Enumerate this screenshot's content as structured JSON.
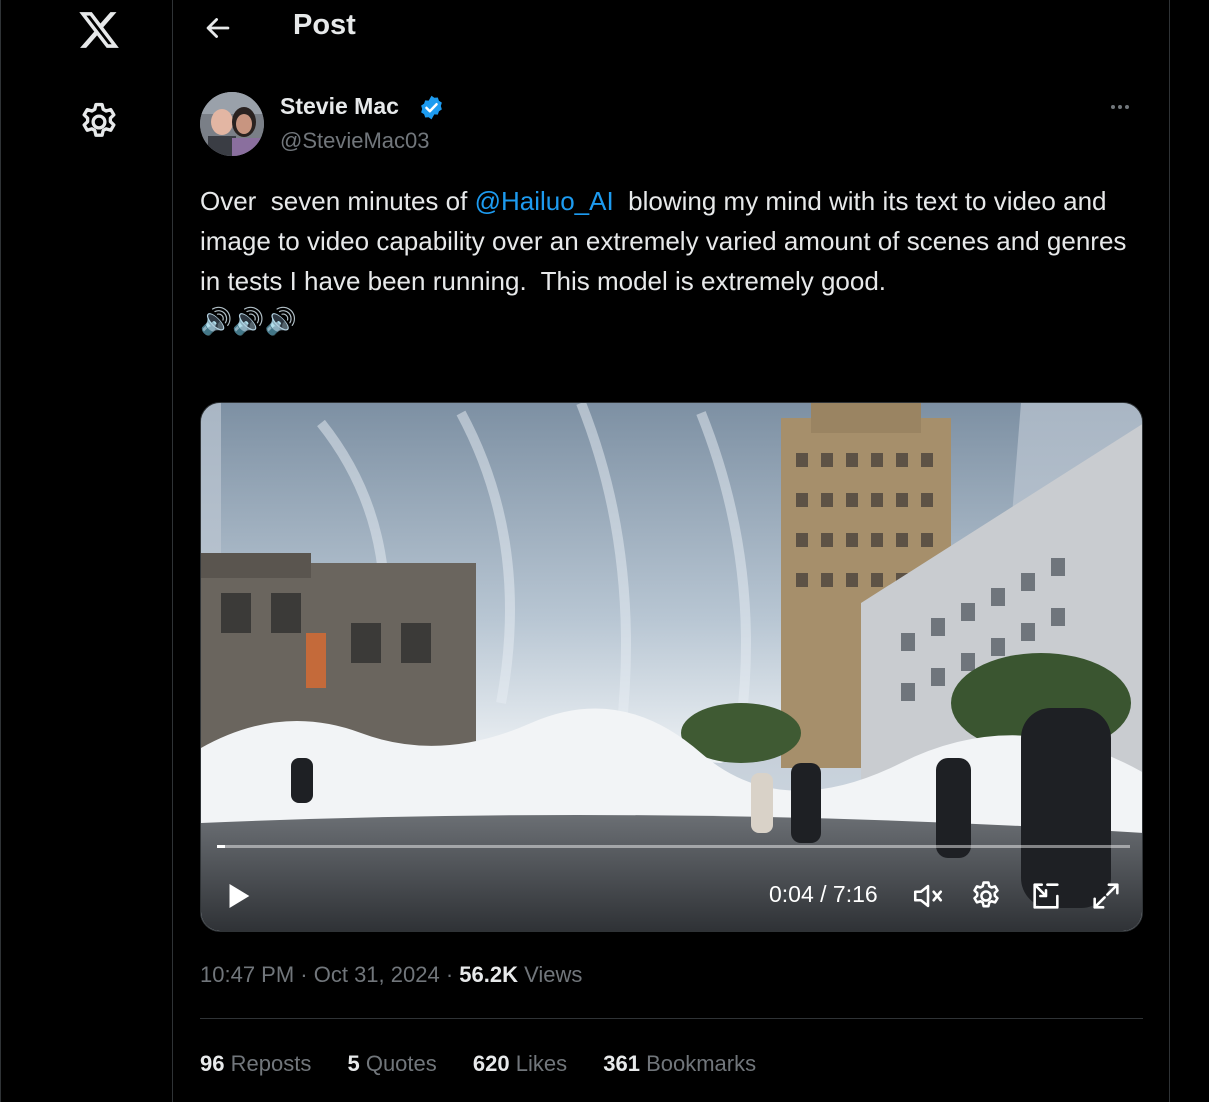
{
  "header": {
    "title": "Post"
  },
  "post": {
    "author": {
      "name": "Stevie Mac",
      "handle": "@StevieMac03",
      "verified": true
    },
    "text_before": "Over  seven minutes of ",
    "mention": "@Hailuo_AI",
    "text_after": "  blowing my mind with its text to video and image to video capability over an extremely varied amount of scenes and genres in tests I have been running.  This model is extremely good.",
    "emoji": "🔊🔊🔊",
    "video": {
      "current_time": "0:04",
      "duration": "7:16",
      "time_display": "0:04 / 7:16",
      "progress": 0.009
    },
    "time": "10:47 PM",
    "date": "Oct 31, 2024",
    "views_count": "56.2K",
    "views_label": "Views",
    "stats": [
      {
        "count": "96",
        "label": "Reposts"
      },
      {
        "count": "5",
        "label": "Quotes"
      },
      {
        "count": "620",
        "label": "Likes"
      },
      {
        "count": "361",
        "label": "Bookmarks"
      }
    ]
  },
  "colors": {
    "background": "#000000",
    "text": "#e7e9ea",
    "muted": "#71767b",
    "accent": "#1d9bf0",
    "border": "#2f3336"
  },
  "icons": {
    "logo": "x-logo-icon",
    "settings": "gear-icon",
    "back": "arrow-left-icon",
    "verified": "verified-badge-icon",
    "more": "more-horizontal-icon",
    "play": "play-icon",
    "mute": "volume-muted-icon",
    "video_settings": "gear-icon",
    "pip": "picture-in-picture-icon",
    "fullscreen": "fullscreen-icon"
  }
}
